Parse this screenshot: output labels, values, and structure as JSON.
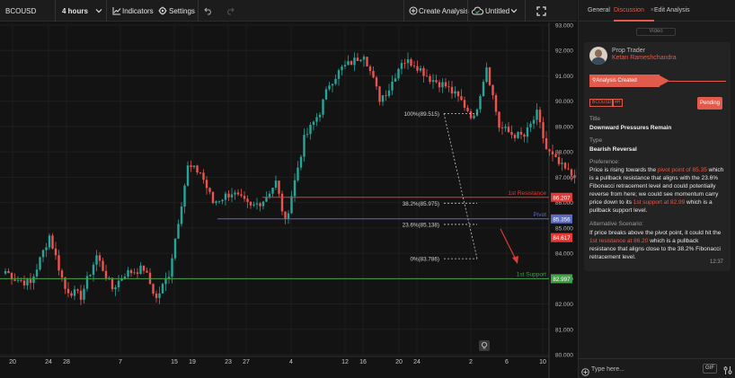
{
  "toolbar": {
    "symbol": "BCOUSD",
    "interval": "4 hours",
    "indicators": "Indicators",
    "settings": "Settings",
    "create_analysis": "Create Analysis",
    "layout_name": "Untitled",
    "icons": [
      "chevron-down-icon",
      "indicators-icon",
      "gear-icon",
      "undo-icon",
      "redo-icon",
      "plus-circle-icon",
      "cloud-check-icon",
      "fullscreen-icon"
    ]
  },
  "chart_data": {
    "type": "candlestick",
    "ylim": [
      80,
      93
    ],
    "y_ticks": [
      "80.000",
      "81.000",
      "82.000",
      "83.000",
      "84.000",
      "85.000",
      "86.000",
      "87.000",
      "88.000",
      "89.000",
      "90.000",
      "91.000",
      "92.000",
      "93.000"
    ],
    "x_ticks": [
      "20",
      "24",
      "28",
      "7",
      "15",
      "19",
      "23",
      "27",
      "4",
      "12",
      "16",
      "20",
      "24",
      "2",
      "6",
      "10"
    ],
    "colors": {
      "up": "#26a69a",
      "down": "#ef5350",
      "resistance": "#e53935",
      "pivot": "#5c6bc0",
      "support": "#43a047",
      "fib": "#c8c8c8",
      "arrow": "#e53935"
    },
    "lines": [
      {
        "name": "1st Resistance",
        "label": "1st Resistance",
        "price": 86.207,
        "price_label": "86.207",
        "color": "#e53935"
      },
      {
        "name": "Pivot",
        "label": "Pivot",
        "price": 85.356,
        "price_label": "85.356",
        "color": "#5c6bc0"
      },
      {
        "name": "1st Support",
        "label": "1st Support",
        "price": 82.997,
        "price_label": "82.997",
        "color": "#43a047"
      }
    ],
    "last_price": {
      "price": 84.617,
      "label": "84.617",
      "color": "#e53935"
    },
    "fibonacci": [
      {
        "label": "100%(89.515)",
        "price": 89.515
      },
      {
        "label": "38.2%(85.975)",
        "price": 85.975
      },
      {
        "label": "23.6%(85.138)",
        "price": 85.138
      },
      {
        "label": "0%(83.786)",
        "price": 83.786
      }
    ],
    "anchors": [
      [
        0,
        83.3
      ],
      [
        3,
        83.0
      ],
      [
        8,
        82.8
      ],
      [
        14,
        84.7
      ],
      [
        19,
        82.6
      ],
      [
        24,
        82.3
      ],
      [
        29,
        83.9
      ],
      [
        34,
        82.6
      ],
      [
        38,
        83.2
      ],
      [
        44,
        83.4
      ],
      [
        48,
        82.2
      ],
      [
        52,
        83.2
      ],
      [
        58,
        87.4
      ],
      [
        62,
        87.2
      ],
      [
        66,
        86.0
      ],
      [
        72,
        86.4
      ],
      [
        78,
        85.8
      ],
      [
        82,
        86.1
      ],
      [
        86,
        86.8
      ],
      [
        89,
        85.2
      ],
      [
        95,
        88.5
      ],
      [
        100,
        89.6
      ],
      [
        103,
        90.7
      ],
      [
        107,
        91.3
      ],
      [
        111,
        91.6
      ],
      [
        114,
        91.9
      ],
      [
        119,
        90.1
      ],
      [
        122,
        90.5
      ],
      [
        126,
        91.6
      ],
      [
        130,
        91.5
      ],
      [
        135,
        90.9
      ],
      [
        140,
        90.6
      ],
      [
        145,
        90.0
      ],
      [
        149,
        89.3
      ],
      [
        153,
        91.4
      ],
      [
        157,
        89.0
      ],
      [
        161,
        88.7
      ],
      [
        165,
        88.6
      ],
      [
        169,
        89.5
      ],
      [
        172,
        88.1
      ],
      [
        176,
        87.5
      ],
      [
        180,
        87.1
      ],
      [
        184,
        87.2
      ],
      [
        187,
        85.7
      ],
      [
        190,
        86.0
      ],
      [
        193,
        86.0
      ],
      [
        197,
        88.1
      ],
      [
        200,
        89.1
      ],
      [
        204,
        88.8
      ],
      [
        208,
        88.0
      ],
      [
        213,
        87.0
      ],
      [
        218,
        86.7
      ],
      [
        220,
        85.5
      ],
      [
        224,
        85.0
      ],
      [
        228,
        84.0
      ],
      [
        232,
        84.4
      ],
      [
        235,
        84.6
      ]
    ],
    "candle_step": 3.5
  },
  "panel": {
    "tabs": [
      "General",
      "Discussion",
      "Edit Analysis"
    ],
    "active_tab": "Discussion",
    "tab_close": "×",
    "video_label": "Video",
    "author_role": "Prop Trader",
    "author_name": "Ketan Rameshchandra",
    "status_label": "Analysis Created",
    "tag_symbol": "BCOUSD",
    "tag_interval": "4H",
    "status_badge": "Pending",
    "title_label": "Title",
    "title_value": "Downward Pressures Remain",
    "type_label": "Type",
    "type_value": "Bearish Reversal",
    "preference_label": "Preference:",
    "preference_parts": [
      "Price is rising towards the ",
      "pivot point of 85.35",
      " which is a pullback resistance that aligns with the 23.6% Fibonacci retracement level and could potentially reverse from here; we could see momentum carry price down to its ",
      "1st support at 82.99",
      " which is a pullback support level."
    ],
    "alternative_label": "Alternative Scenario:",
    "alternative_parts": [
      "If price breaks above the pivot point, it could hit the ",
      "1st resistance at 86.20",
      " which is a pullback resistance that aligns close to the 38.2% Fibonacci retracement level."
    ],
    "timestamp": "12:37",
    "input_placeholder": "Type here...",
    "gif_label": "GIF"
  }
}
